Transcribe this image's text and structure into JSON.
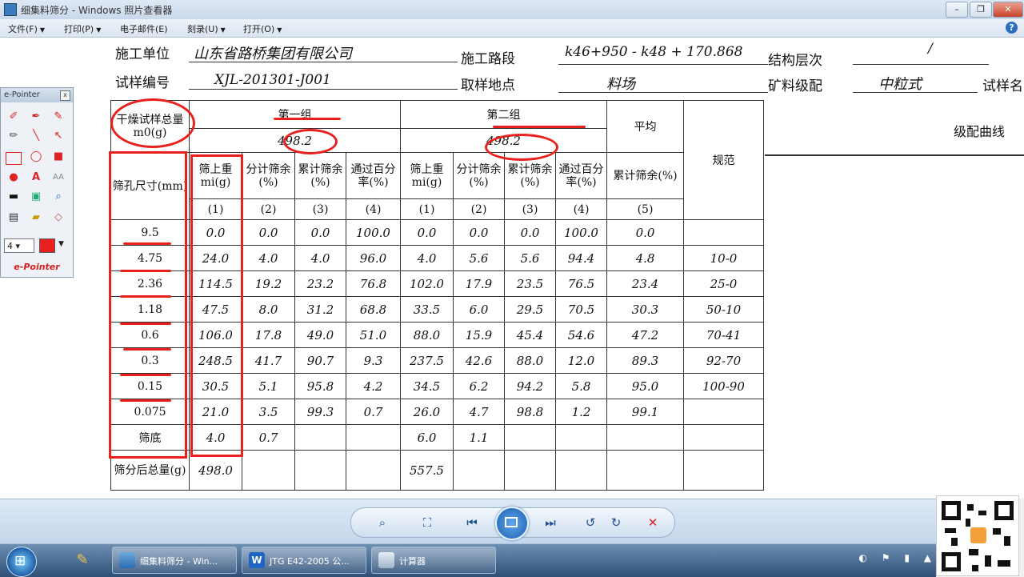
{
  "window": {
    "title": "细集料筛分 - Windows 照片查看器",
    "btn_min": "–",
    "btn_max": "❐",
    "btn_close": "✕"
  },
  "menubar": {
    "items": [
      {
        "label": "文件(F)"
      },
      {
        "label": "打印(P)"
      },
      {
        "label": "电子邮件(E)"
      },
      {
        "label": "刻录(U)"
      },
      {
        "label": "打开(O)"
      }
    ],
    "help": "?"
  },
  "epointer": {
    "title": "e-Pointer",
    "close": "x",
    "size_value": "4",
    "footer": "e-Pointer",
    "tools": [
      "eraser-icon",
      "pen-icon",
      "marker-icon",
      "pencil-icon",
      "line-icon",
      "arrow-icon",
      "rectangle-icon",
      "ellipse-icon",
      "filled-rectangle-icon",
      "filled-ellipse-icon",
      "text-icon",
      "font-size-icon",
      "thick-line-icon",
      "screen-icon",
      "zoom-icon",
      "save-icon",
      "open-icon",
      "clear-icon"
    ]
  },
  "document": {
    "header": {
      "label_unit": "施工单位",
      "value_unit": "山东省路桥集团有限公司",
      "label_road": "施工路段",
      "value_road": "k46+950 - k48 + 170.868",
      "label_layer": "结构层次",
      "value_layer": "/",
      "label_sample_no": "试样编号",
      "value_sample_no": "XJL-201301-J001",
      "label_sample_place": "取样地点",
      "value_sample_place": "料场",
      "label_gradation": "矿料级配",
      "value_gradation": "中粒式",
      "label_sample_name": "试样名"
    },
    "table": {
      "dry_total_label": "干燥试样总量m0(g)",
      "group1": "第一组",
      "group2": "第二组",
      "group1_total": "498.2",
      "group2_total": "498.2",
      "average": "平均",
      "spec": "规范",
      "curve": "级配曲线",
      "sieve_col": "筛孔尺寸(mm)",
      "col_retained": "筛上重mi(g)",
      "col_partial": "分计筛余(%)",
      "col_cumulative": "累计筛余(%)",
      "col_passing": "通过百分率(%)",
      "col_avg_cumulative": "累计筛余(%)",
      "col_nums_g1": [
        "(1)",
        "(2)",
        "(3)",
        "(4)"
      ],
      "col_nums_g2": [
        "(1)",
        "(2)",
        "(3)",
        "(4)"
      ],
      "col_num_avg": "(5)",
      "rows": [
        {
          "sieve": "9.5",
          "g1": [
            "0.0",
            "0.0",
            "0.0",
            "100.0"
          ],
          "g2": [
            "0.0",
            "0.0",
            "0.0",
            "100.0"
          ],
          "avg": "0.0",
          "spec": ""
        },
        {
          "sieve": "4.75",
          "g1": [
            "24.0",
            "4.0",
            "4.0",
            "96.0"
          ],
          "g2": [
            "4.0",
            "5.6",
            "5.6",
            "94.4"
          ],
          "avg": "4.8",
          "spec": "10-0"
        },
        {
          "sieve": "2.36",
          "g1": [
            "114.5",
            "19.2",
            "23.2",
            "76.8"
          ],
          "g2": [
            "102.0",
            "17.9",
            "23.5",
            "76.5"
          ],
          "avg": "23.4",
          "spec": "25-0"
        },
        {
          "sieve": "1.18",
          "g1": [
            "47.5",
            "8.0",
            "31.2",
            "68.8"
          ],
          "g2": [
            "33.5",
            "6.0",
            "29.5",
            "70.5"
          ],
          "avg": "30.3",
          "spec": "50-10"
        },
        {
          "sieve": "0.6",
          "g1": [
            "106.0",
            "17.8",
            "49.0",
            "51.0"
          ],
          "g2": [
            "88.0",
            "15.9",
            "45.4",
            "54.6"
          ],
          "avg": "47.2",
          "spec": "70-41"
        },
        {
          "sieve": "0.3",
          "g1": [
            "248.5",
            "41.7",
            "90.7",
            "9.3"
          ],
          "g2": [
            "237.5",
            "42.6",
            "88.0",
            "12.0"
          ],
          "avg": "89.3",
          "spec": "92-70"
        },
        {
          "sieve": "0.15",
          "g1": [
            "30.5",
            "5.1",
            "95.8",
            "4.2"
          ],
          "g2": [
            "34.5",
            "6.2",
            "94.2",
            "5.8"
          ],
          "avg": "95.0",
          "spec": "100-90"
        },
        {
          "sieve": "0.075",
          "g1": [
            "21.0",
            "3.5",
            "99.3",
            "0.7"
          ],
          "g2": [
            "26.0",
            "4.7",
            "98.8",
            "1.2"
          ],
          "avg": "99.1",
          "spec": ""
        },
        {
          "sieve": "筛底",
          "g1": [
            "4.0",
            "0.7",
            "",
            ""
          ],
          "g2": [
            "6.0",
            "1.1",
            "",
            ""
          ],
          "avg": "",
          "spec": ""
        }
      ],
      "total_after_label": "筛分后总量(g)",
      "total_after_g1": "498.0",
      "total_after_g2": "557.5"
    }
  },
  "viewer_toolbar": {
    "zoom": "⌕",
    "fit": "⛶",
    "prev": "⏮",
    "next": "⏭",
    "rotate_ccw": "↺",
    "rotate_cw": "↻",
    "delete": "✕"
  },
  "taskbar": {
    "start": "⊞",
    "tasks": [
      {
        "label": "细集料筛分 - Win..."
      },
      {
        "label": "JTG E42-2005 公..."
      },
      {
        "label": "计算器"
      }
    ],
    "tray": [
      "◐",
      "⚑",
      "▮",
      "▲"
    ]
  }
}
